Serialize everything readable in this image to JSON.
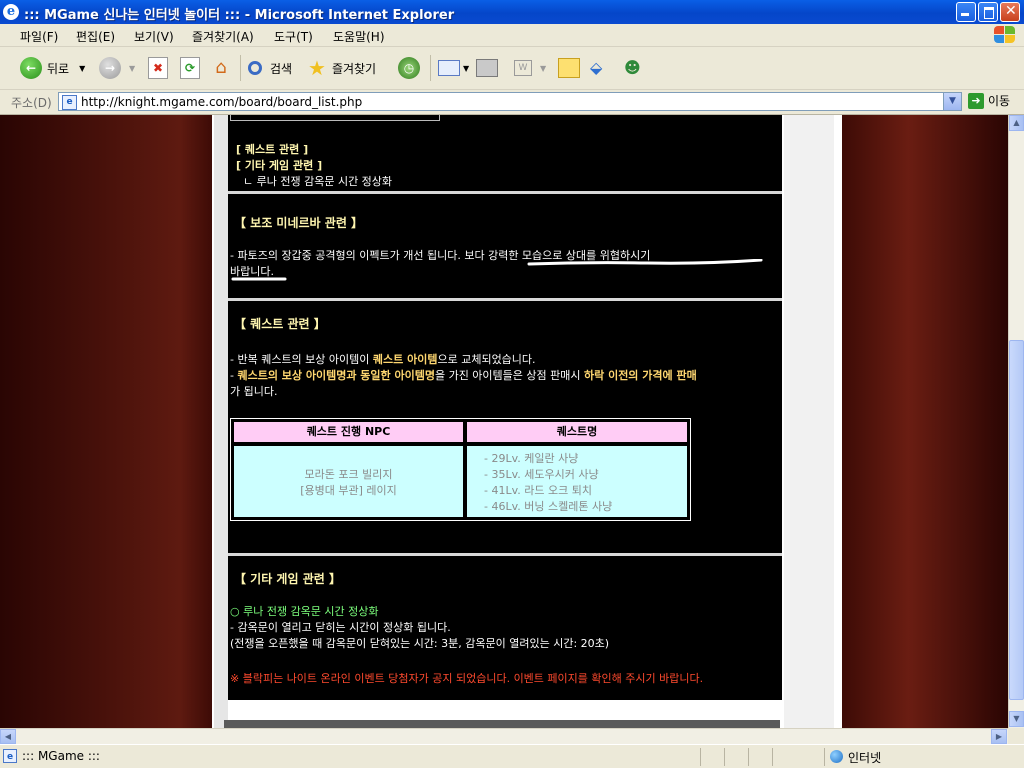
{
  "window": {
    "title": "::: MGame 신나는 인터넷 놀이터 ::: - Microsoft Internet Explorer"
  },
  "menu": [
    "파일(F)",
    "편집(E)",
    "보기(V)",
    "즐겨찾기(A)",
    "도구(T)",
    "도움말(H)"
  ],
  "toolbar": {
    "back": "뒤로",
    "search": "검색",
    "favorites": "즐겨찾기"
  },
  "address": {
    "label": "주소(D)",
    "url": "http://knight.mgame.com/board/board_list.php",
    "go": "이동"
  },
  "content": {
    "toc": {
      "quest": "[ 퀘스트 관련 ]",
      "etc": "[ 기타 게임 관련 ]",
      "etc_sub": "ㄴ 루나 전쟁 감옥문 시간 정상화"
    },
    "minerva": {
      "heading": "【 보조 미네르바 관련 】",
      "line1_a": "- 파토즈의 장갑중 공격형의 이펙트가 개선 됩니다. ",
      "line1_b": "보다 강력한 모습으로 상대를 위협하시기",
      "line2": "바랍니다."
    },
    "quest": {
      "heading": "【 퀘스트 관련 】",
      "line1_a": "- 반복 퀘스트의 보상 아이템이 ",
      "line1_b": "퀘스트 아이템",
      "line1_c": "으로 교체되었습니다.",
      "line2_a": "- ",
      "line2_b": "퀘스트의 보상 아이템명과 동일한 아이템명",
      "line2_c": "을 가진 아이템들은 상점 판매시 ",
      "line2_d": "하락 이전의 가격에 판매",
      "line3": "가 됩니다.",
      "table": {
        "headers": [
          "퀘스트 진행 NPC",
          "퀘스트명"
        ],
        "npc": [
          "모라돈 포크 빌리지",
          "[용병대 부관] 레이지"
        ],
        "quests": [
          "- 29Lv. 케일란 사냥",
          "- 35Lv. 세도우시커 사냥",
          "- 41Lv. 라드 오크 퇴치",
          "- 46Lv. 버닝 스켈레톤 사냥"
        ]
      }
    },
    "etc": {
      "heading": "【 기타 게임 관련 】",
      "item": "○ 루나 전쟁 감옥문 시간 정상화",
      "line1": "- 감옥문이 열리고 닫히는 시간이 정상화 됩니다.",
      "line2": "(전쟁을 오픈했을 때 감옥문이 닫혀있는 시간: 3분, 감옥문이 열려있는 시간: 20초)",
      "notice": "※ 블락피는 나이트 온라인 이벤트 당첨자가 공지 되었습니다. 이벤트 페이지를 확인해 주시기 바랍니다."
    }
  },
  "status": {
    "text": "::: MGame :::",
    "zone": "인터넷"
  },
  "colors": {
    "title_bar": "#0A5FE6",
    "content_bg": "#000000",
    "table_header": "#ffccf5",
    "table_cell": "#ccffff",
    "highlight": "#ffd770",
    "green": "#7cff7c",
    "red_notice": "#ff4a2e"
  }
}
